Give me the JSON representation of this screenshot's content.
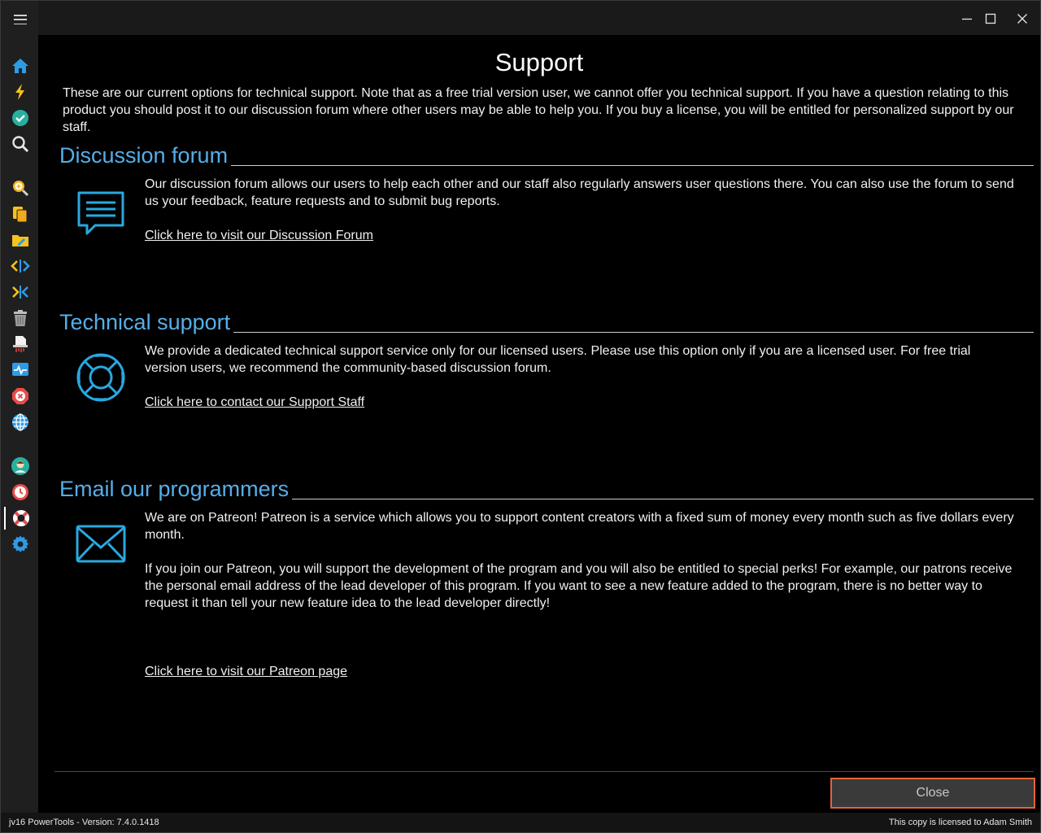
{
  "window": {
    "minimize_label": "Minimize",
    "maximize_label": "Maximize",
    "close_label": "Close window"
  },
  "sidebar": {
    "items": [
      {
        "name": "home-icon",
        "color": "#2e9be6"
      },
      {
        "name": "lightning-icon",
        "color": "#f6c21c"
      },
      {
        "name": "checkmark-icon",
        "color": "#27b0a0"
      },
      {
        "name": "search-icon",
        "color": "#d9d9d9"
      },
      {
        "name": "zoom-plus-icon",
        "color": "#f2b41f"
      },
      {
        "name": "copy-files-icon",
        "color": "#f6c21c"
      },
      {
        "name": "folder-edit-icon",
        "color": "#f6c21c"
      },
      {
        "name": "code-icon",
        "color": "#2e9be6"
      },
      {
        "name": "split-arrows-icon",
        "color": "#2e9be6"
      },
      {
        "name": "trash-icon",
        "color": "#bdbdbd"
      },
      {
        "name": "shredder-icon",
        "color": "#e6e6e6"
      },
      {
        "name": "monitor-icon",
        "color": "#2e9be6"
      },
      {
        "name": "error-icon",
        "color": "#e84b4b"
      },
      {
        "name": "globe-icon",
        "color": "#2e9be6"
      },
      {
        "name": "user-avatar-icon",
        "color": "#27b0a0"
      },
      {
        "name": "clock-icon",
        "color": "#e84b4b"
      },
      {
        "name": "lifebuoy-icon",
        "color": "#e84b4b"
      },
      {
        "name": "gear-icon",
        "color": "#2e9be6"
      }
    ]
  },
  "page": {
    "title": "Support",
    "intro": "These are our current options for technical support. Note that as a free trial version user, we cannot offer you technical support. If you have a question relating to this product you should post it to our discussion forum where other users may be able to help you. If you buy a license, you will be entitled for personalized support by our staff."
  },
  "sections": {
    "forum": {
      "heading": "Discussion forum",
      "body": "Our discussion forum allows our users to help each other and our staff also regularly answers user questions there. You can also use the forum to send us your feedback, feature requests and to submit bug reports.",
      "link": "Click here to visit our Discussion Forum",
      "icon": "chat-bubble-icon"
    },
    "support": {
      "heading": "Technical support",
      "body": "We provide a dedicated technical support service only for our licensed users. Please use this option only if you are a licensed user. For free trial version users, we recommend the community-based discussion forum.",
      "link": "Click here to contact our Support Staff",
      "icon": "lifebuoy-icon"
    },
    "email": {
      "heading": "Email our programmers",
      "body1": "We are on Patreon! Patreon is a service which allows you to support content creators with a fixed sum of money every month such as five dollars every month.",
      "body2": "If you join our Patreon, you will support the development of the program and you will also be entitled to special perks! For example, our patrons receive the personal email address of the lead developer of this program. If you want to see a new feature added to the program, there is no better way to request it than tell your new feature idea to the lead developer directly!",
      "link": "Click here to visit our Patreon page",
      "icon": "envelope-icon"
    }
  },
  "footer": {
    "close_button": "Close",
    "status_left": "jv16 PowerTools - Version: 7.4.0.1418",
    "status_right": "This copy is licensed to Adam Smith"
  },
  "colors": {
    "accent": "#56aee8",
    "icon_blue": "#29a8e0",
    "close_border": "#e8623a"
  }
}
